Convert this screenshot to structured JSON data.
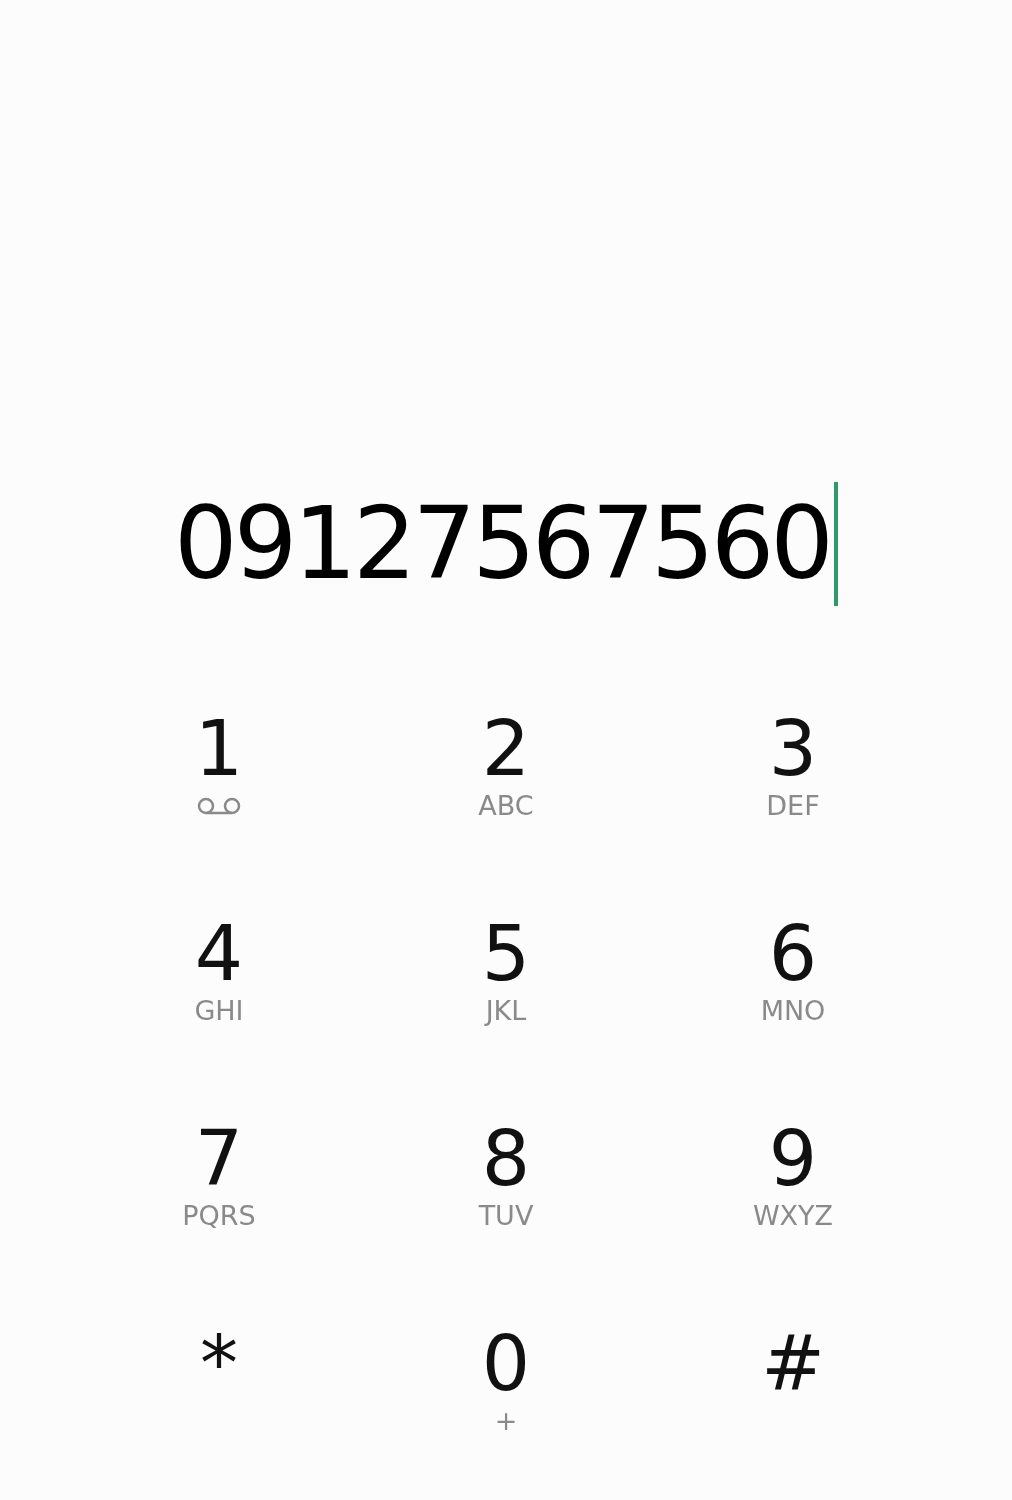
{
  "number_field": {
    "value": "09127567560",
    "cursor": true
  },
  "keypad": [
    {
      "digit": "1",
      "kind": "voicemail"
    },
    {
      "digit": "2",
      "letters": "ABC",
      "kind": "letters"
    },
    {
      "digit": "3",
      "letters": "DEF",
      "kind": "letters"
    },
    {
      "digit": "4",
      "letters": "GHI",
      "kind": "letters"
    },
    {
      "digit": "5",
      "letters": "JKL",
      "kind": "letters"
    },
    {
      "digit": "6",
      "letters": "MNO",
      "kind": "letters"
    },
    {
      "digit": "7",
      "letters": "PQRS",
      "kind": "letters"
    },
    {
      "digit": "8",
      "letters": "TUV",
      "kind": "letters"
    },
    {
      "digit": "9",
      "letters": "WXYZ",
      "kind": "letters"
    },
    {
      "digit": "*",
      "kind": "plain"
    },
    {
      "digit": "0",
      "letters": "+",
      "kind": "letters"
    },
    {
      "digit": "#",
      "kind": "plain"
    }
  ]
}
